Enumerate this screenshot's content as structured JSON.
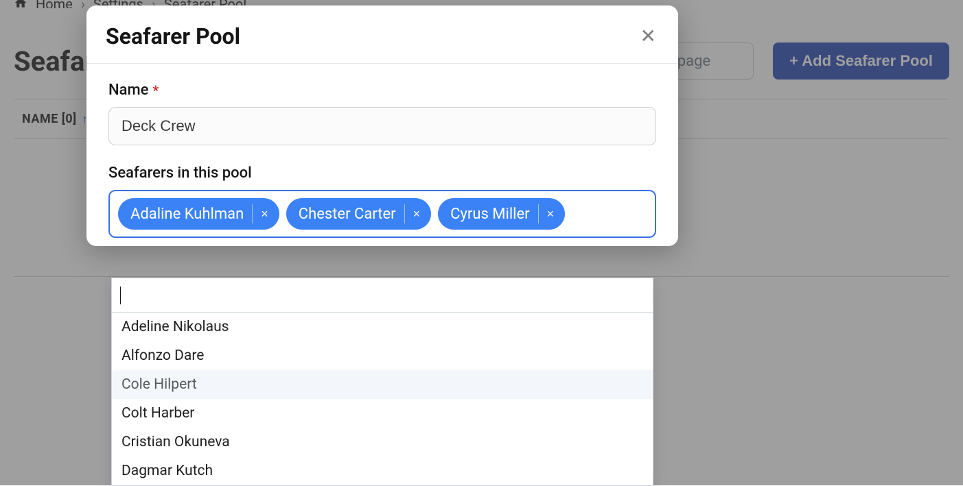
{
  "breadcrumb": {
    "home": "Home",
    "settings": "Settings",
    "current": "Seafarer Pool"
  },
  "page": {
    "title": "Seafarer Pool",
    "search_placeholder": "Search on the page",
    "add_button": "+ Add Seafarer Pool"
  },
  "table": {
    "col_name": "NAME [0]"
  },
  "modal": {
    "title": "Seafarer Pool",
    "name_label": "Name",
    "name_value": "Deck Crew",
    "seafarers_label": "Seafarers in this pool",
    "chips": [
      {
        "label": "Adaline Kuhlman"
      },
      {
        "label": "Chester Carter"
      },
      {
        "label": "Cyrus Miller"
      }
    ],
    "dropdown": {
      "search_value": "",
      "items": [
        "Adeline Nikolaus",
        "Alfonzo Dare",
        "Cole Hilpert",
        "Colt Harber",
        "Cristian Okuneva",
        "Dagmar Kutch"
      ],
      "highlighted_index": 2
    }
  }
}
